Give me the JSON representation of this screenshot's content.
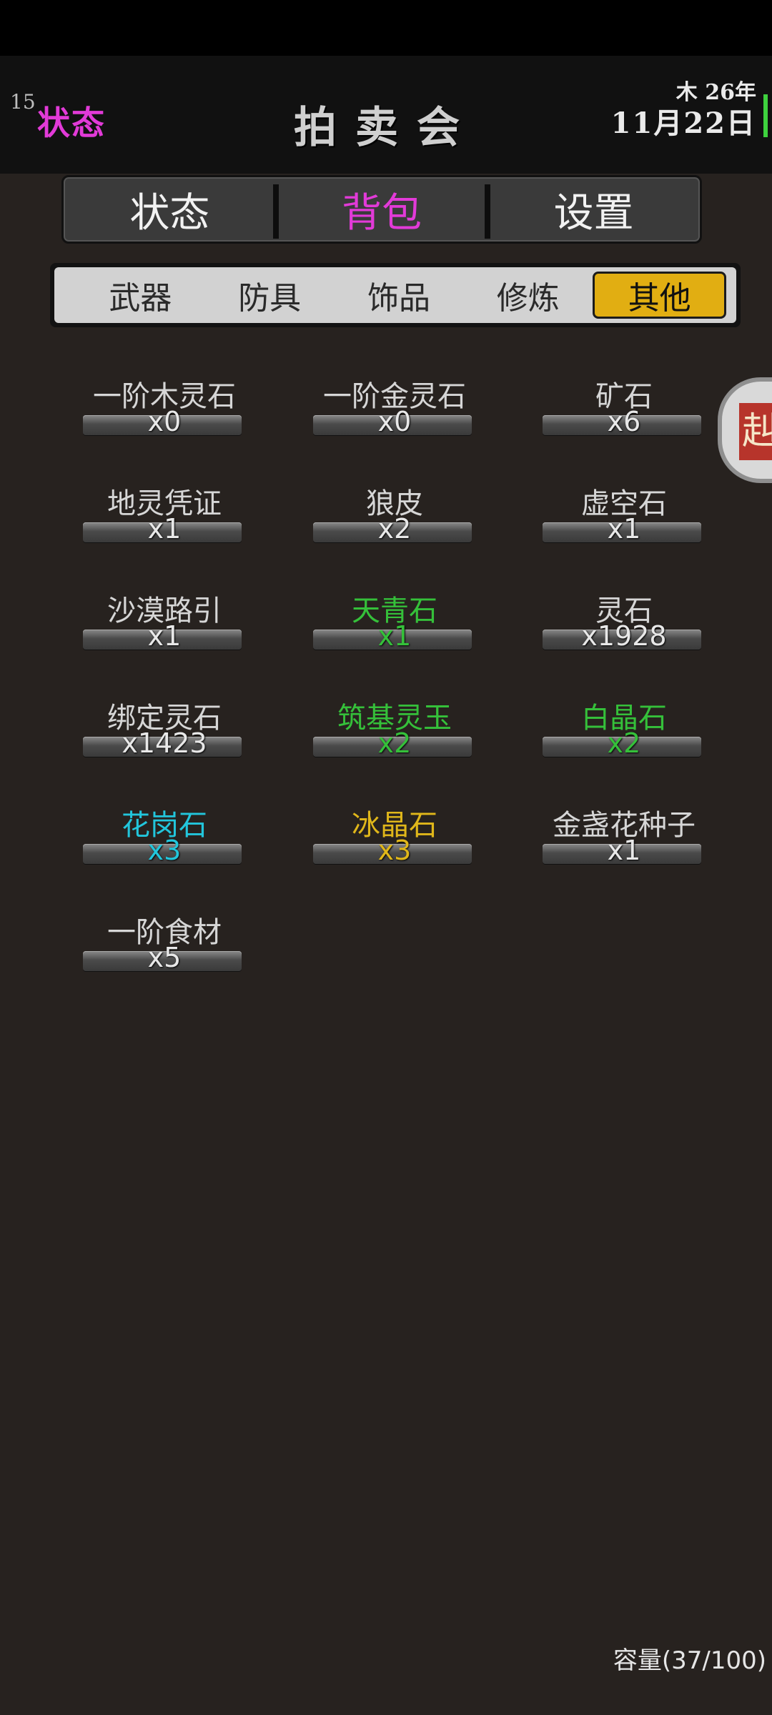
{
  "header": {
    "level": "15",
    "status_link": "状态",
    "title": "拍卖会",
    "date_top": "木 26年",
    "date_bottom": "11月22日"
  },
  "main_tabs": [
    {
      "label": "状态",
      "active": false
    },
    {
      "label": "背包",
      "active": true
    },
    {
      "label": "设置",
      "active": false
    }
  ],
  "sub_tabs": [
    {
      "label": "武器",
      "active": false
    },
    {
      "label": "防具",
      "active": false
    },
    {
      "label": "饰品",
      "active": false
    },
    {
      "label": "修炼",
      "active": false
    },
    {
      "label": "其他",
      "active": true
    }
  ],
  "items": [
    {
      "name": "一阶木灵石",
      "qty": "x0",
      "color": "#d6d6d6"
    },
    {
      "name": "一阶金灵石",
      "qty": "x0",
      "color": "#d6d6d6"
    },
    {
      "name": "矿石",
      "qty": "x6",
      "color": "#d6d6d6"
    },
    {
      "name": "地灵凭证",
      "qty": "x1",
      "color": "#d6d6d6"
    },
    {
      "name": "狼皮",
      "qty": "x2",
      "color": "#d6d6d6"
    },
    {
      "name": "虚空石",
      "qty": "x1",
      "color": "#d6d6d6"
    },
    {
      "name": "沙漠路引",
      "qty": "x1",
      "color": "#d6d6d6"
    },
    {
      "name": "天青石",
      "qty": "x1",
      "color": "#35c03a"
    },
    {
      "name": "灵石",
      "qty": "x1928",
      "color": "#d6d6d6"
    },
    {
      "name": "绑定灵石",
      "qty": "x1423",
      "color": "#d6d6d6"
    },
    {
      "name": "筑基灵玉",
      "qty": "x2",
      "color": "#35c03a"
    },
    {
      "name": "白晶石",
      "qty": "x2",
      "color": "#35c03a"
    },
    {
      "name": "花岗石",
      "qty": "x3",
      "color": "#22c6dc"
    },
    {
      "name": "冰晶石",
      "qty": "x3",
      "color": "#e0b71a"
    },
    {
      "name": "金盏花种子",
      "qty": "x1",
      "color": "#d6d6d6"
    },
    {
      "name": "一阶食材",
      "qty": "x5",
      "color": "#d6d6d6"
    }
  ],
  "side_button": {
    "glyph": "赳"
  },
  "capacity": "容量(37/100)"
}
